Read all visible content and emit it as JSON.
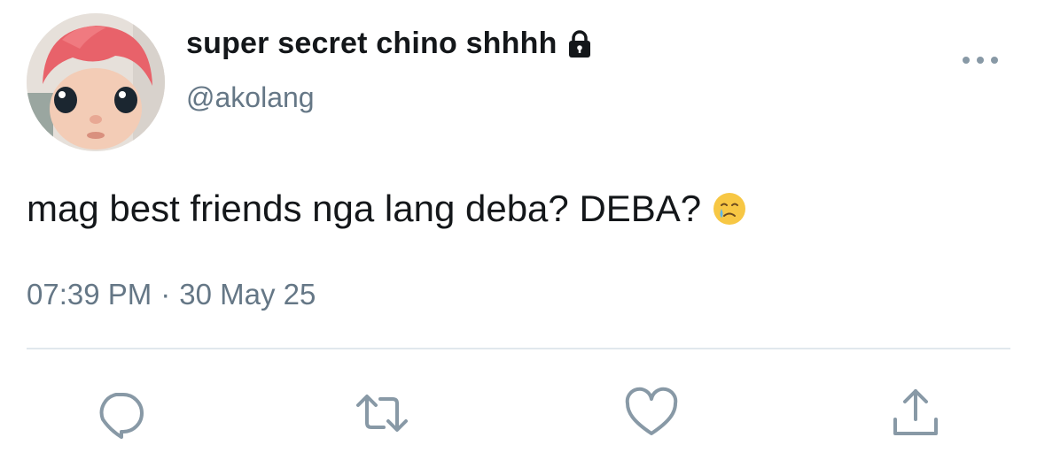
{
  "tweet": {
    "display_name": "super secret chino shhhh",
    "handle": "@akolang",
    "text": "mag best friends nga lang deba? DEBA?",
    "time": "07:39 PM",
    "separator": "·",
    "date": "30 May 25"
  },
  "icons": {
    "lock": "lock-icon",
    "more": "more-options-icon",
    "emoji": "face-holding-back-tears-emoji",
    "reply": "reply-icon",
    "retweet": "retweet-icon",
    "like": "heart-icon",
    "share": "share-icon"
  },
  "colors": {
    "text": "#14171a",
    "secondary_text": "#657786",
    "icon": "#8899a6",
    "divider": "#e1e8ed"
  }
}
